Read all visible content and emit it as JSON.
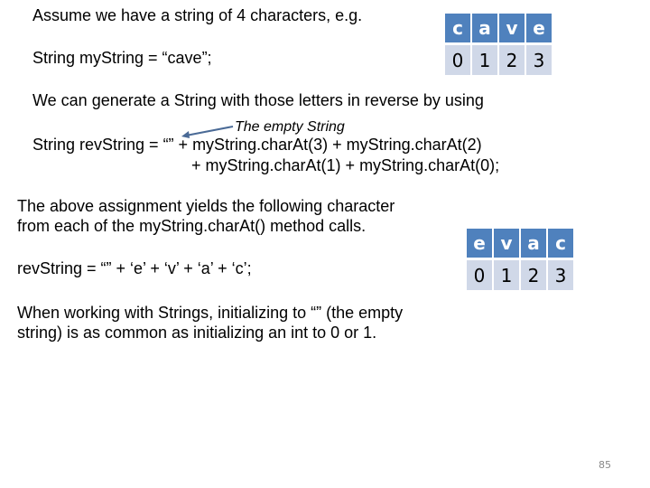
{
  "slide": {
    "intro": "Assume we have a string of 4 characters, e.g.",
    "declaration": "String myString = “cave”;",
    "reverse_intro": "We can generate a String with those letters in reverse by using",
    "annotation": "The empty String",
    "rev_line1": "String revString = “” + myString.charAt(3) + myString.charAt(2)",
    "rev_line2": "+  myString.charAt(1) + myString.charAt(0);",
    "yields_line1": "The above assignment yields the following character",
    "yields_line2": "from each of the myString.charAt() method calls.",
    "rev_result": "revString = “” + ‘e’ + ‘v’ + ‘a’ + ‘c’;",
    "note_line1": "When working with Strings, initializing to “” (the empty",
    "note_line2": "string) is as common as initializing an int to 0 or 1.",
    "page_number": "85"
  },
  "tables": {
    "original": {
      "chars": [
        "c",
        "a",
        "v",
        "e"
      ],
      "indices": [
        "0",
        "1",
        "2",
        "3"
      ]
    },
    "reversed": {
      "chars": [
        "e",
        "v",
        "a",
        "c"
      ],
      "indices": [
        "0",
        "1",
        "2",
        "3"
      ]
    }
  },
  "colors": {
    "header_fill": "#4f81bd",
    "index_fill": "#d0d8e8",
    "arrow": "#4a6a96"
  }
}
